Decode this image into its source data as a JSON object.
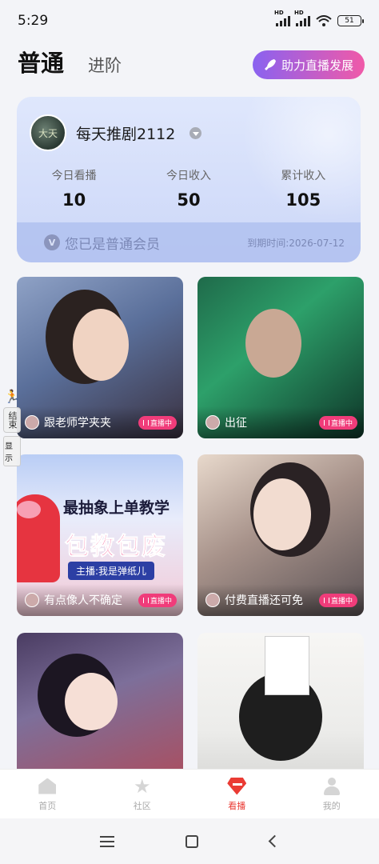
{
  "status_bar": {
    "time": "5:29",
    "signal1_label": "HD",
    "signal2_label": "HD",
    "battery": "51"
  },
  "tabs": {
    "active": "普通",
    "inactive": "进阶"
  },
  "boost_button": {
    "label": "助力直播发展",
    "icon": "rocket-icon"
  },
  "member_card": {
    "username": "每天推剧2112",
    "avatar_text": "大天",
    "stats": [
      {
        "label": "今日看播",
        "value": "10"
      },
      {
        "label": "今日收入",
        "value": "50"
      },
      {
        "label": "累计收入",
        "value": "105"
      }
    ],
    "member_status": "您已是普通会员",
    "vip_badge": "V",
    "expire": "到期时间:2026-07-12"
  },
  "streams": [
    {
      "name": "跟老师学夹夹",
      "live": "直播中"
    },
    {
      "name": "出征",
      "live": "直播中"
    },
    {
      "name": "有点像人不确定",
      "live": "直播中",
      "poster_line1": "最抽象上单教学",
      "poster_line2": "包教包废",
      "poster_tag": "主播:我是弹纸儿"
    },
    {
      "name": "付费直播还可免",
      "live": "直播中"
    },
    {
      "name": "",
      "live": ""
    },
    {
      "name": "",
      "live": ""
    }
  ],
  "side_float": {
    "label": "结束",
    "show": "显示"
  },
  "bottom_nav": [
    {
      "label": "首页",
      "icon": "home-icon"
    },
    {
      "label": "社区",
      "icon": "star-icon"
    },
    {
      "label": "看播",
      "icon": "gem-icon"
    },
    {
      "label": "我的",
      "icon": "profile-icon"
    }
  ],
  "colors": {
    "accent": "#ea3b34",
    "live_badge": "#f03c7a",
    "boost_gradient_start": "#8a62f0",
    "boost_gradient_end": "#f05aa8"
  }
}
